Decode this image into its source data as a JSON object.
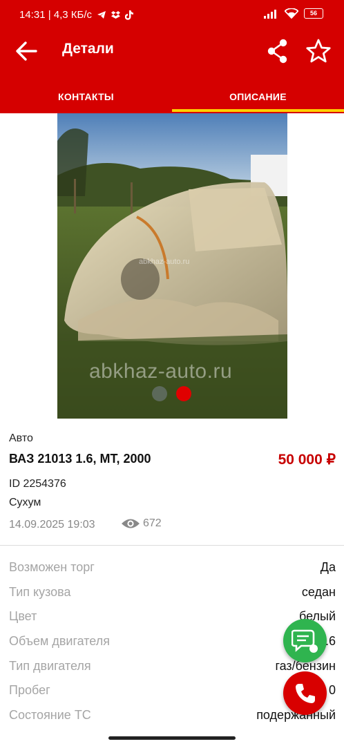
{
  "status_bar": {
    "time_speed": "14:31 | 4,3 КБ/с",
    "battery": "56"
  },
  "toolbar": {
    "title": "Детали"
  },
  "tabs": [
    {
      "label": "КОНТАКТЫ",
      "active": false
    },
    {
      "label": "ОПИСАНИЕ",
      "active": true
    }
  ],
  "photo": {
    "watermark": "abkhaz-auto.ru",
    "watermark_small": "abkhaz-auto.ru",
    "slide_count": 2,
    "active_slide": 2
  },
  "listing": {
    "category": "Авто",
    "name": "ВАЗ 21013 1.6, MT, 2000",
    "price": "50 000 ₽",
    "id": "ID 2254376",
    "city": "Сухум",
    "date": "14.09.2025 19:03",
    "views": "672"
  },
  "specs": [
    {
      "key": "Возможен торг",
      "value": "Да"
    },
    {
      "key": "Тип кузова",
      "value": "седан"
    },
    {
      "key": "Цвет",
      "value": "белый"
    },
    {
      "key": "Объем двигателя",
      "value": "1.6"
    },
    {
      "key": "Тип двигателя",
      "value": "газ/бензин"
    },
    {
      "key": "Пробег",
      "value": "0"
    },
    {
      "key": "Состояние ТС",
      "value": "подержанный"
    }
  ],
  "colors": {
    "brand_red": "#d50000",
    "tab_indicator": "#ffd000",
    "price_red": "#c70000",
    "chat_green": "#2fb44f"
  },
  "icons": [
    "back-arrow-icon",
    "share-icon",
    "star-icon",
    "eye-icon",
    "chat-icon",
    "phone-icon"
  ]
}
